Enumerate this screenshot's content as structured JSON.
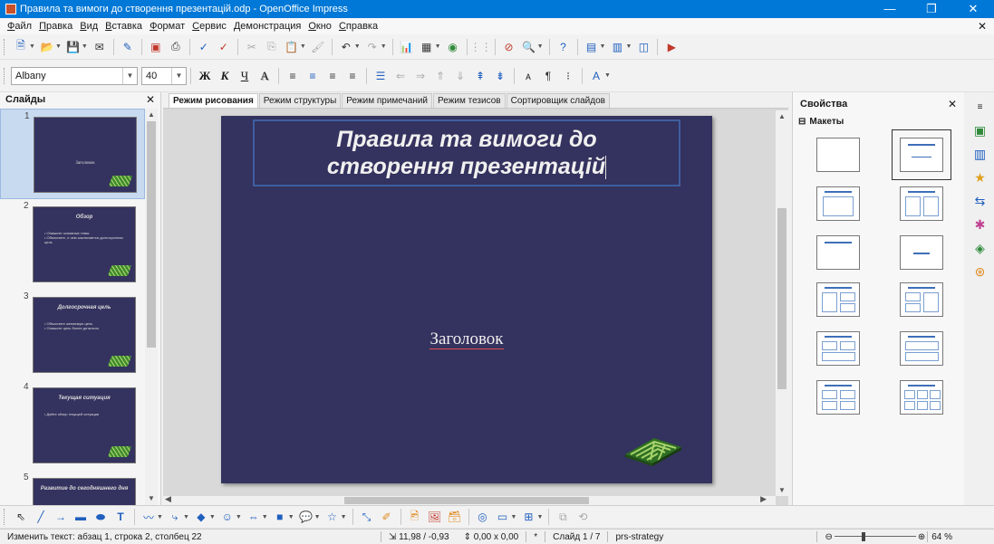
{
  "window": {
    "title": "Правила та вимоги до створення презентацій.odp - OpenOffice Impress",
    "minimize": "—",
    "maximize": "❐",
    "close": "✕"
  },
  "menu": [
    "Файл",
    "Правка",
    "Вид",
    "Вставка",
    "Формат",
    "Сервис",
    "Демонстрация",
    "Окно",
    "Справка"
  ],
  "menu_close": "✕",
  "format_toolbar": {
    "font_name": "Albany",
    "font_size": "40",
    "bold": "Ж",
    "italic": "К",
    "underline": "Ч",
    "shadow": "A"
  },
  "slides_panel": {
    "title": "Слайды",
    "close": "✕",
    "slides": [
      {
        "num": "1",
        "title": "",
        "center": "Заголовок",
        "body": ""
      },
      {
        "num": "2",
        "title": "Обзор",
        "center": "",
        "body": "• Опишите основные темы\n• Объясните, о чем заключается долгосрочная цель"
      },
      {
        "num": "3",
        "title": "Долгосрочная цель",
        "center": "",
        "body": "• Объясните желаемую цель\n• Опишите цель более детально"
      },
      {
        "num": "4",
        "title": "Текущая ситуация",
        "center": "",
        "body": "• Дайте обзор текущей ситуации"
      },
      {
        "num": "5",
        "title": "Развитие до сегодняшнего дня",
        "center": "",
        "body": ""
      }
    ]
  },
  "tabs": [
    "Режим рисования",
    "Режим структуры",
    "Режим примечаний",
    "Режим тезисов",
    "Сортировщик слайдов"
  ],
  "slide": {
    "title_line1": "Правила та вимоги до",
    "title_line2": "створення презентацій",
    "content": "Заголовок"
  },
  "properties": {
    "title": "Свойства",
    "close": "✕",
    "section": "Макеты",
    "section_toggle": "⊟"
  },
  "statusbar": {
    "edit_info": "Изменить текст: абзац 1, строка 2, столбец 22",
    "position": "11,98 / -0,93",
    "size": "0,00 x 0,00",
    "modified": "*",
    "slide_info": "Слайд 1 / 7",
    "master": "prs-strategy",
    "zoom_minus": "⊖",
    "zoom_plus": "⊕",
    "zoom": "64 %"
  },
  "colors": {
    "titlebar": "#0078d7",
    "slide_background": "#34325e",
    "title_frame": "#3e5fa0"
  }
}
